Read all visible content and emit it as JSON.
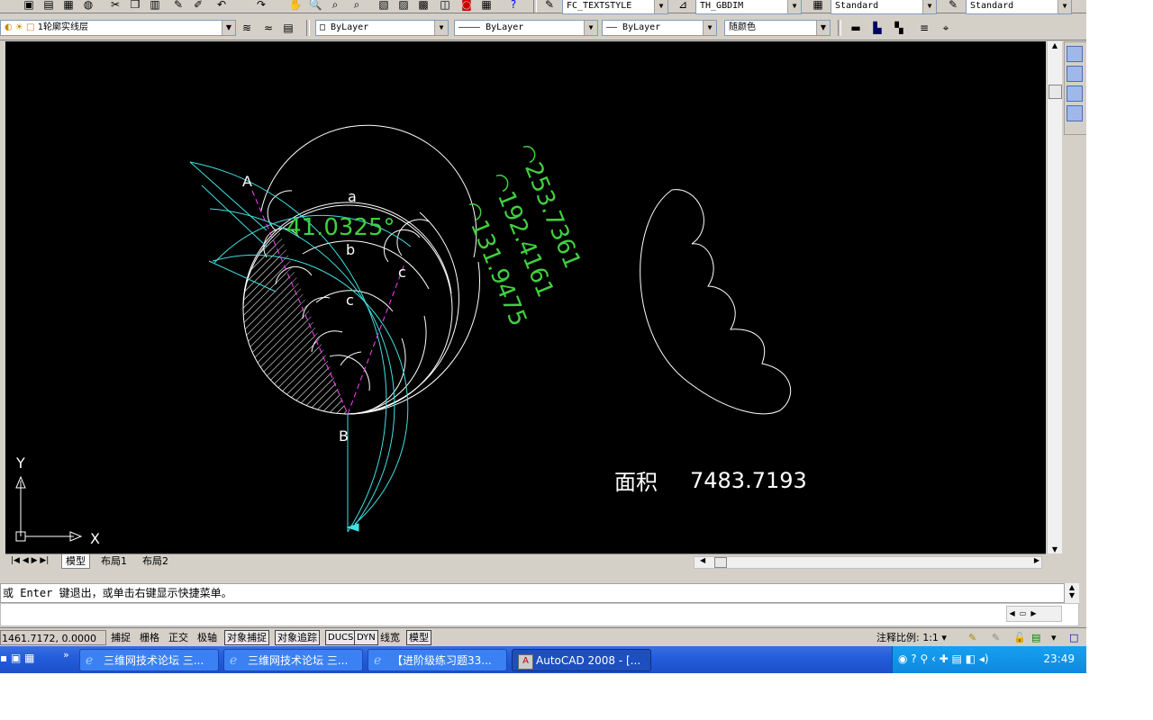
{
  "toolbar_top": {
    "textstyle": "FC_TEXTSTYLE",
    "dimstyle": "TH_GBDIM",
    "tablestyle": "Standard",
    "mleaderstyle": "Standard"
  },
  "toolbar_layers": {
    "layer": "1轮廓实线层",
    "color": "ByLayer",
    "linetype": "———— ByLayer",
    "lineweight": "—— ByLayer",
    "plotstyle": "随颜色"
  },
  "drawing": {
    "labels": {
      "A": "A",
      "B": "B",
      "a": "a",
      "b": "b",
      "c": "c"
    },
    "dims": {
      "angle": "41.0325°",
      "arc1": "◠253.7361",
      "arc2": "◠192.4161",
      "arc3": "◠131.9475"
    },
    "area_label": "面积",
    "area_value": "7483.7193",
    "ucs": {
      "x": "X",
      "y": "Y"
    }
  },
  "tabs": [
    "模型",
    "布局1",
    "布局2"
  ],
  "command_line": "或 Enter 键退出，或单击右键显示快捷菜单。",
  "status": {
    "coords": "1461.7172, 0.0000",
    "toggles": [
      {
        "label": "捕捉",
        "on": false
      },
      {
        "label": "栅格",
        "on": false
      },
      {
        "label": "正交",
        "on": false
      },
      {
        "label": "极轴",
        "on": false
      },
      {
        "label": "对象捕捉",
        "on": true
      },
      {
        "label": "对象追踪",
        "on": true
      },
      {
        "label": "DUCS",
        "on": true
      },
      {
        "label": "DYN",
        "on": true
      },
      {
        "label": "线宽",
        "on": false
      },
      {
        "label": "模型",
        "on": true
      }
    ],
    "annotation_scale": "注释比例: 1:1 ▾"
  },
  "taskbar": {
    "tasks": [
      {
        "label": "三维网技术论坛 三..."
      },
      {
        "label": "三维网技术论坛 三..."
      },
      {
        "label": "【进阶级练习题33..."
      },
      {
        "label": "AutoCAD 2008 - [..."
      }
    ],
    "time": "23:49"
  },
  "colors": {
    "canvas": "#000000",
    "cyan": "#40e0e0",
    "green": "#40d040",
    "magenta": "#ff40ff",
    "white": "#ffffff"
  }
}
